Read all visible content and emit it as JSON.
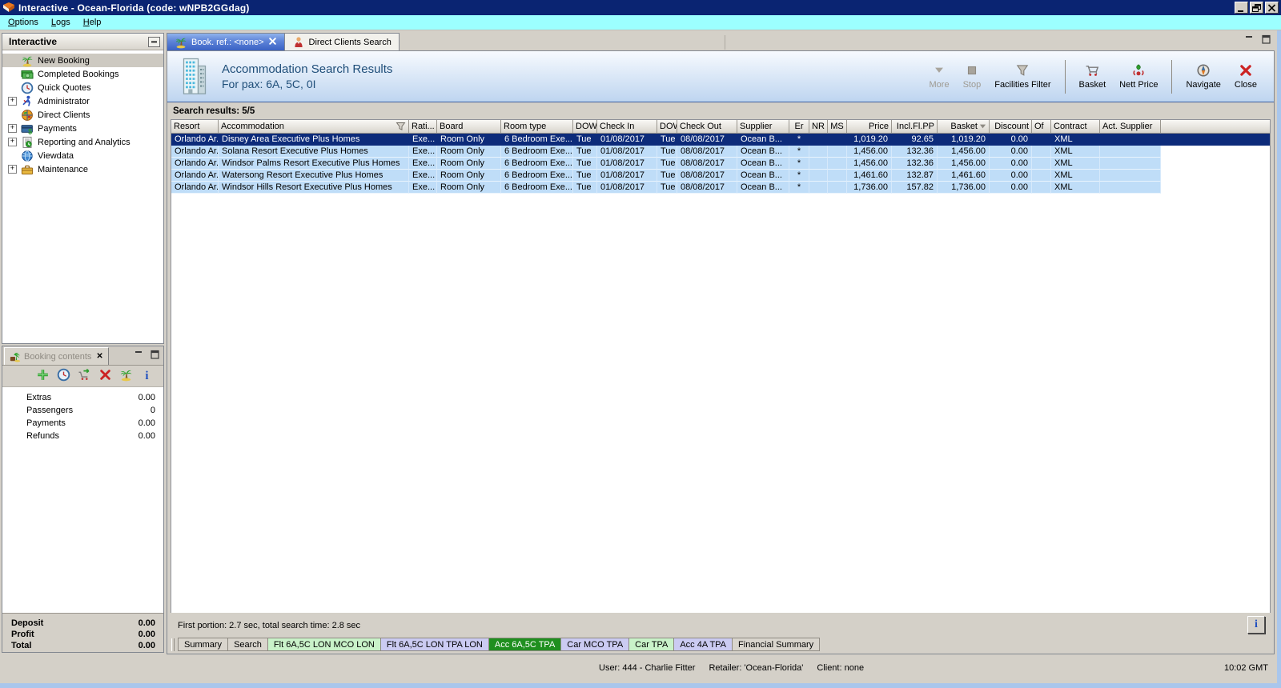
{
  "window": {
    "title": "Interactive - Ocean-Florida (code: wNPB2GGdag)"
  },
  "menu": {
    "items": [
      "Options",
      "Logs",
      "Help"
    ]
  },
  "sidebar": {
    "title": "Interactive",
    "items": [
      {
        "label": "New Booking",
        "icon": "palm",
        "selected": true
      },
      {
        "label": "Completed Bookings",
        "icon": "money"
      },
      {
        "label": "Quick Quotes",
        "icon": "clock"
      },
      {
        "label": "Administrator",
        "icon": "person",
        "expandable": true
      },
      {
        "label": "Direct Clients",
        "icon": "globe"
      },
      {
        "label": "Payments",
        "icon": "payments",
        "expandable": true
      },
      {
        "label": "Reporting and Analytics",
        "icon": "report",
        "expandable": true
      },
      {
        "label": "Viewdata",
        "icon": "viewdata"
      },
      {
        "label": "Maintenance",
        "icon": "toolbox",
        "expandable": true
      }
    ]
  },
  "booking_contents": {
    "title": "Booking contents",
    "toolbar": [
      {
        "name": "add",
        "icon": "add"
      },
      {
        "name": "quick-quote",
        "icon": "clock"
      },
      {
        "name": "transfer-basket",
        "icon": "cart-arrow"
      },
      {
        "name": "delete",
        "icon": "delete"
      },
      {
        "name": "new-booking",
        "icon": "palm"
      },
      {
        "name": "info",
        "icon": "info"
      }
    ],
    "items": [
      {
        "label": "Extras",
        "value": "0.00"
      },
      {
        "label": "Passengers",
        "value": "0"
      },
      {
        "label": "Payments",
        "value": "0.00"
      },
      {
        "label": "Refunds",
        "value": "0.00"
      }
    ],
    "totals": [
      {
        "label": "Deposit",
        "value": "0.00"
      },
      {
        "label": "Profit",
        "value": "0.00"
      },
      {
        "label": "Total",
        "value": "0.00"
      }
    ]
  },
  "main": {
    "tabs": [
      {
        "label": "Book. ref.: <none>",
        "icon": "palm",
        "active": true,
        "closable": true
      },
      {
        "label": "Direct Clients Search",
        "icon": "person2",
        "active": false
      }
    ],
    "header": {
      "title": "Accommodation Search Results",
      "subtitle": "For pax: 6A, 5C, 0I"
    },
    "toolbar": [
      {
        "label": "More",
        "icon": "more",
        "disabled": true
      },
      {
        "label": "Stop",
        "icon": "stop",
        "disabled": true
      },
      {
        "label": "Facilities Filter",
        "icon": "funnel"
      },
      {
        "separator": true
      },
      {
        "label": "Basket",
        "icon": "basket"
      },
      {
        "label": "Nett Price",
        "icon": "nett-price"
      },
      {
        "separator": true
      },
      {
        "label": "Navigate",
        "icon": "navigate"
      },
      {
        "label": "Close",
        "icon": "close"
      }
    ],
    "results_label": "Search results: 5/5",
    "table": {
      "columns": [
        "Resort",
        "Accommodation",
        "Rati...",
        "Board",
        "Room type",
        "DOW",
        "Check In",
        "DOW",
        "Check Out",
        "Supplier",
        "Er",
        "NR",
        "MS",
        "Price",
        "Incl.Fl.PP",
        "Basket",
        "Discount",
        "Of",
        "Contract",
        "Act. Supplier"
      ],
      "rows": [
        [
          "Orlando Ar...",
          "Disney Area Executive Plus Homes",
          "Exe...",
          "Room Only",
          "6 Bedroom Exe...",
          "Tue",
          "01/08/2017",
          "Tue",
          "08/08/2017",
          "Ocean B...",
          "*",
          "",
          "",
          "1,019.20",
          "92.65",
          "1,019.20",
          "0.00",
          "",
          "XML",
          ""
        ],
        [
          "Orlando Ar...",
          "Solana Resort Executive Plus Homes",
          "Exe...",
          "Room Only",
          "6 Bedroom Exe...",
          "Tue",
          "01/08/2017",
          "Tue",
          "08/08/2017",
          "Ocean B...",
          "*",
          "",
          "",
          "1,456.00",
          "132.36",
          "1,456.00",
          "0.00",
          "",
          "XML",
          ""
        ],
        [
          "Orlando Ar...",
          "Windsor Palms Resort Executive Plus Homes",
          "Exe...",
          "Room Only",
          "6 Bedroom Exe...",
          "Tue",
          "01/08/2017",
          "Tue",
          "08/08/2017",
          "Ocean B...",
          "*",
          "",
          "",
          "1,456.00",
          "132.36",
          "1,456.00",
          "0.00",
          "",
          "XML",
          ""
        ],
        [
          "Orlando Ar...",
          "Watersong Resort Executive Plus Homes",
          "Exe...",
          "Room Only",
          "6 Bedroom Exe...",
          "Tue",
          "01/08/2017",
          "Tue",
          "08/08/2017",
          "Ocean B...",
          "*",
          "",
          "",
          "1,461.60",
          "132.87",
          "1,461.60",
          "0.00",
          "",
          "XML",
          ""
        ],
        [
          "Orlando Ar...",
          "Windsor Hills Resort Executive Plus Homes",
          "Exe...",
          "Room Only",
          "6 Bedroom Exe...",
          "Tue",
          "01/08/2017",
          "Tue",
          "08/08/2017",
          "Ocean B...",
          "*",
          "",
          "",
          "1,736.00",
          "157.82",
          "1,736.00",
          "0.00",
          "",
          "XML",
          ""
        ]
      ]
    },
    "status_text": "First portion: 2.7 sec, total search time: 2.8 sec",
    "info_button_label": "i",
    "bottom_tabs": [
      {
        "label": "Summary",
        "style": "default"
      },
      {
        "label": "Search",
        "style": "default"
      },
      {
        "label": "Flt 6A,5C LON MCO LON",
        "style": "green-light"
      },
      {
        "label": "Flt 6A,5C LON TPA LON",
        "style": "lavender"
      },
      {
        "label": "Acc 6A,5C TPA",
        "style": "green-active"
      },
      {
        "label": "Car MCO TPA",
        "style": "lavender"
      },
      {
        "label": "Car TPA",
        "style": "green-light"
      },
      {
        "label": "Acc 4A TPA",
        "style": "lavender"
      },
      {
        "label": "Financial Summary",
        "style": "default"
      }
    ]
  },
  "status_bar": {
    "segments": [
      "User: 444 - Charlie Fitter",
      "Retailer: 'Ocean-Florida'",
      "Client: none"
    ],
    "time": "10:02 GMT"
  },
  "colors": {
    "titlebar": "#0A2472",
    "menubar": "#9CFFFF",
    "selected_row": "#0D2B7A",
    "row_blue": "#BFDDF8",
    "active_tab_green": "#1F8F1F",
    "tab_green_light": "#C9F2C9",
    "tab_lavender": "#CBCBF2",
    "banner_text": "#1F4E79"
  }
}
